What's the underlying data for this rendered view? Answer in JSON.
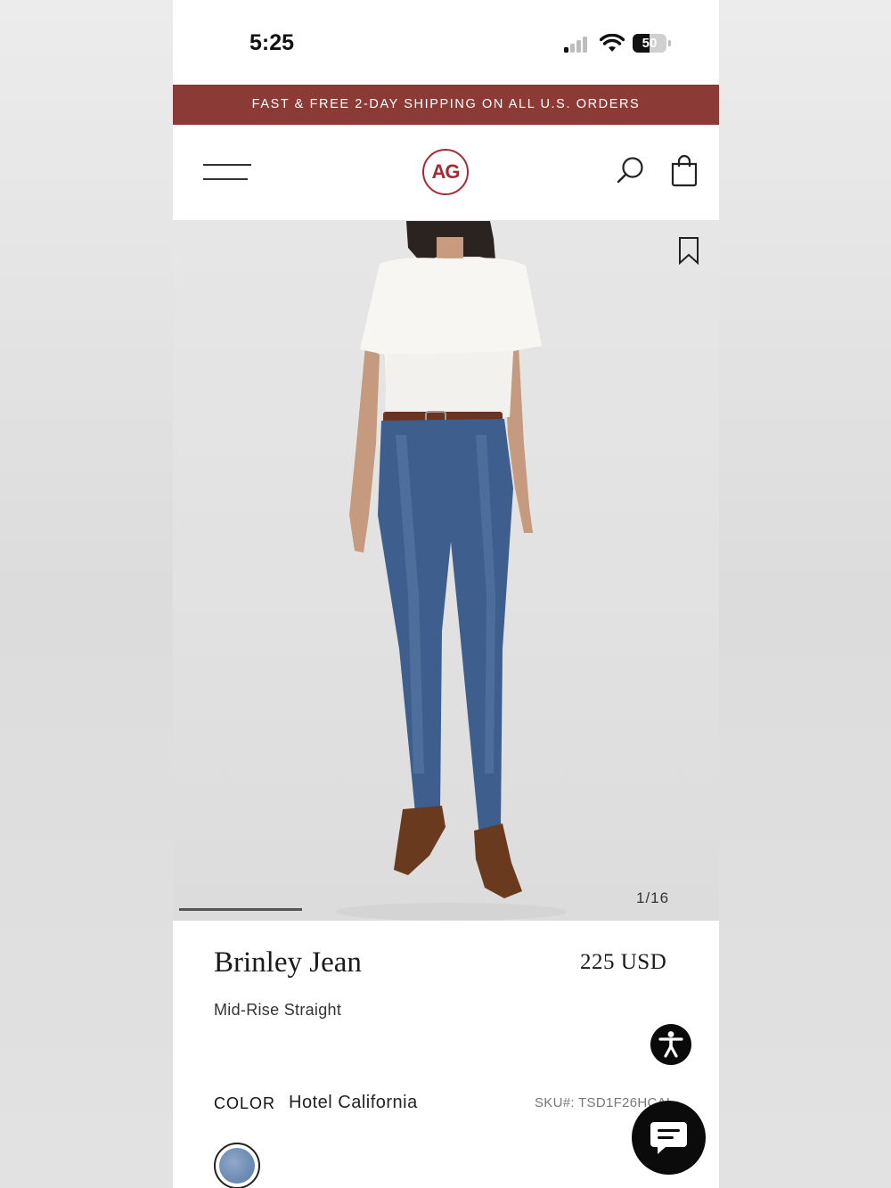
{
  "status_bar": {
    "time": "5:25",
    "battery": "50",
    "battery_level": 0.5
  },
  "promo": {
    "text": "FAST & FREE 2-DAY SHIPPING ON ALL U.S. ORDERS",
    "background": "#8c3a36"
  },
  "header": {
    "logo": "AG",
    "logo_color": "#a52a36",
    "icons": [
      "menu-icon",
      "search-icon",
      "shopping-bag-icon"
    ]
  },
  "gallery": {
    "counter": "1/16",
    "current": 1,
    "total": 16,
    "icon": "bookmark-icon"
  },
  "product": {
    "name": "Brinley Jean",
    "price": "225 USD",
    "fit": "Mid-Rise Straight",
    "color_label": "COLOR",
    "color_value": "Hotel California",
    "sku": "SKU#: TSD1F26HCAL"
  },
  "widgets": {
    "accessibility_icon": "accessibility-icon",
    "chat_icon": "chat-icon"
  }
}
